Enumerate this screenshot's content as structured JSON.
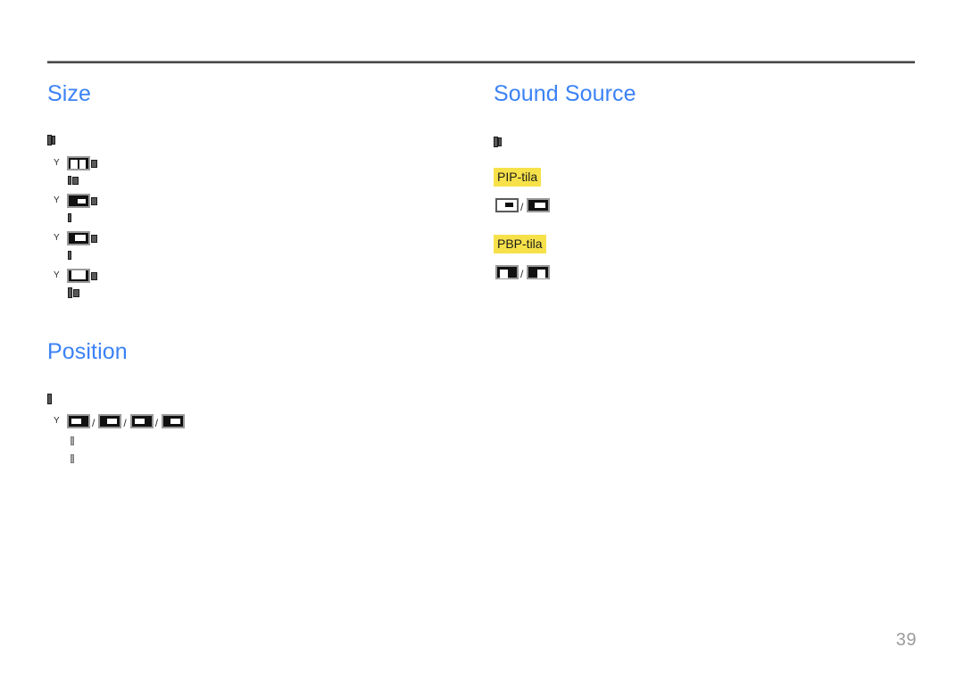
{
  "document": {
    "page_number": "39",
    "heading_color": "#3b82f6",
    "highlight_color": "#f7e14a",
    "rule_color": "#4a4a4a",
    "page_number_color": "#9c9c9c"
  },
  "columns": {
    "left": {
      "sections": [
        {
          "id": "size",
          "heading": "Size",
          "intro_glyph": "missing-glyph",
          "options": [
            {
              "marker": "Y",
              "icon": "pip-size-off",
              "caption_glyph": "missing-glyph"
            },
            {
              "marker": "Y",
              "icon": "pip-size-small",
              "caption_glyph": "missing-glyph"
            },
            {
              "marker": "Y",
              "icon": "pip-size-medium",
              "caption_glyph": "missing-glyph"
            },
            {
              "marker": "Y",
              "icon": "pip-size-large",
              "caption_glyph": "missing-glyph"
            }
          ]
        },
        {
          "id": "position",
          "heading": "Position",
          "intro_glyph": "missing-glyph",
          "options": [
            {
              "marker": "Y",
              "icons": [
                "position-top-left",
                "position-top-right",
                "position-bottom-left",
                "position-bottom-right"
              ],
              "separator": "/",
              "caption_glyphs": [
                "missing-glyph",
                "missing-glyph"
              ]
            }
          ]
        }
      ]
    },
    "right": {
      "sections": [
        {
          "id": "sound-source",
          "heading": "Sound Source",
          "intro_glyph": "missing-glyph",
          "groups": [
            {
              "label": "PIP-tila",
              "highlighted": true,
              "icons": [
                "pip-sound-sub",
                "pip-sound-main"
              ],
              "separator": "/"
            },
            {
              "label": "PBP-tila",
              "highlighted": true,
              "icons": [
                "pbp-sound-left",
                "pbp-sound-right"
              ],
              "separator": "/"
            }
          ]
        }
      ]
    }
  }
}
